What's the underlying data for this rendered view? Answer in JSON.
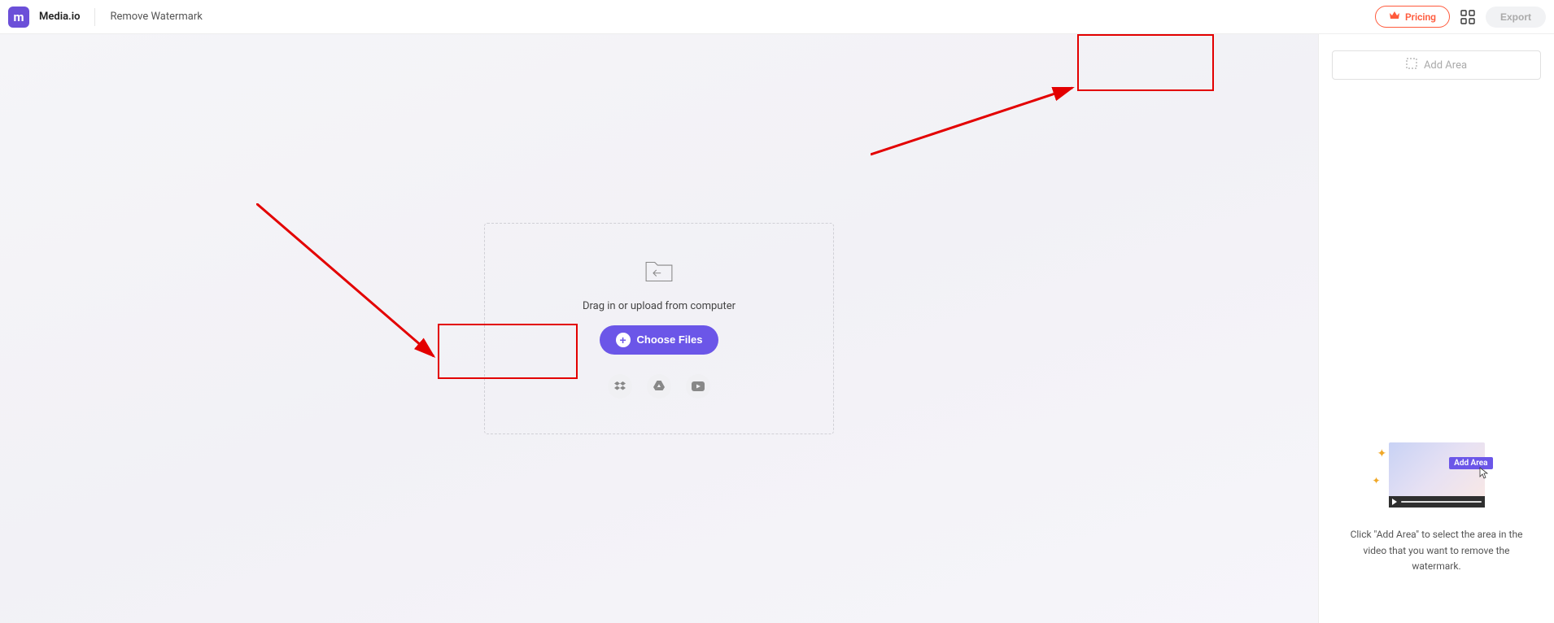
{
  "header": {
    "brand": "Media.io",
    "tool_name": "Remove Watermark",
    "pricing_label": "Pricing",
    "export_label": "Export"
  },
  "upload": {
    "hint": "Drag in or upload from computer",
    "choose_label": "Choose Files"
  },
  "sidebar": {
    "add_area_label": "Add Area",
    "preview_badge": "Add Area",
    "hint": "Click \"Add Area\" to select the area in the video that you want to remove the watermark."
  }
}
